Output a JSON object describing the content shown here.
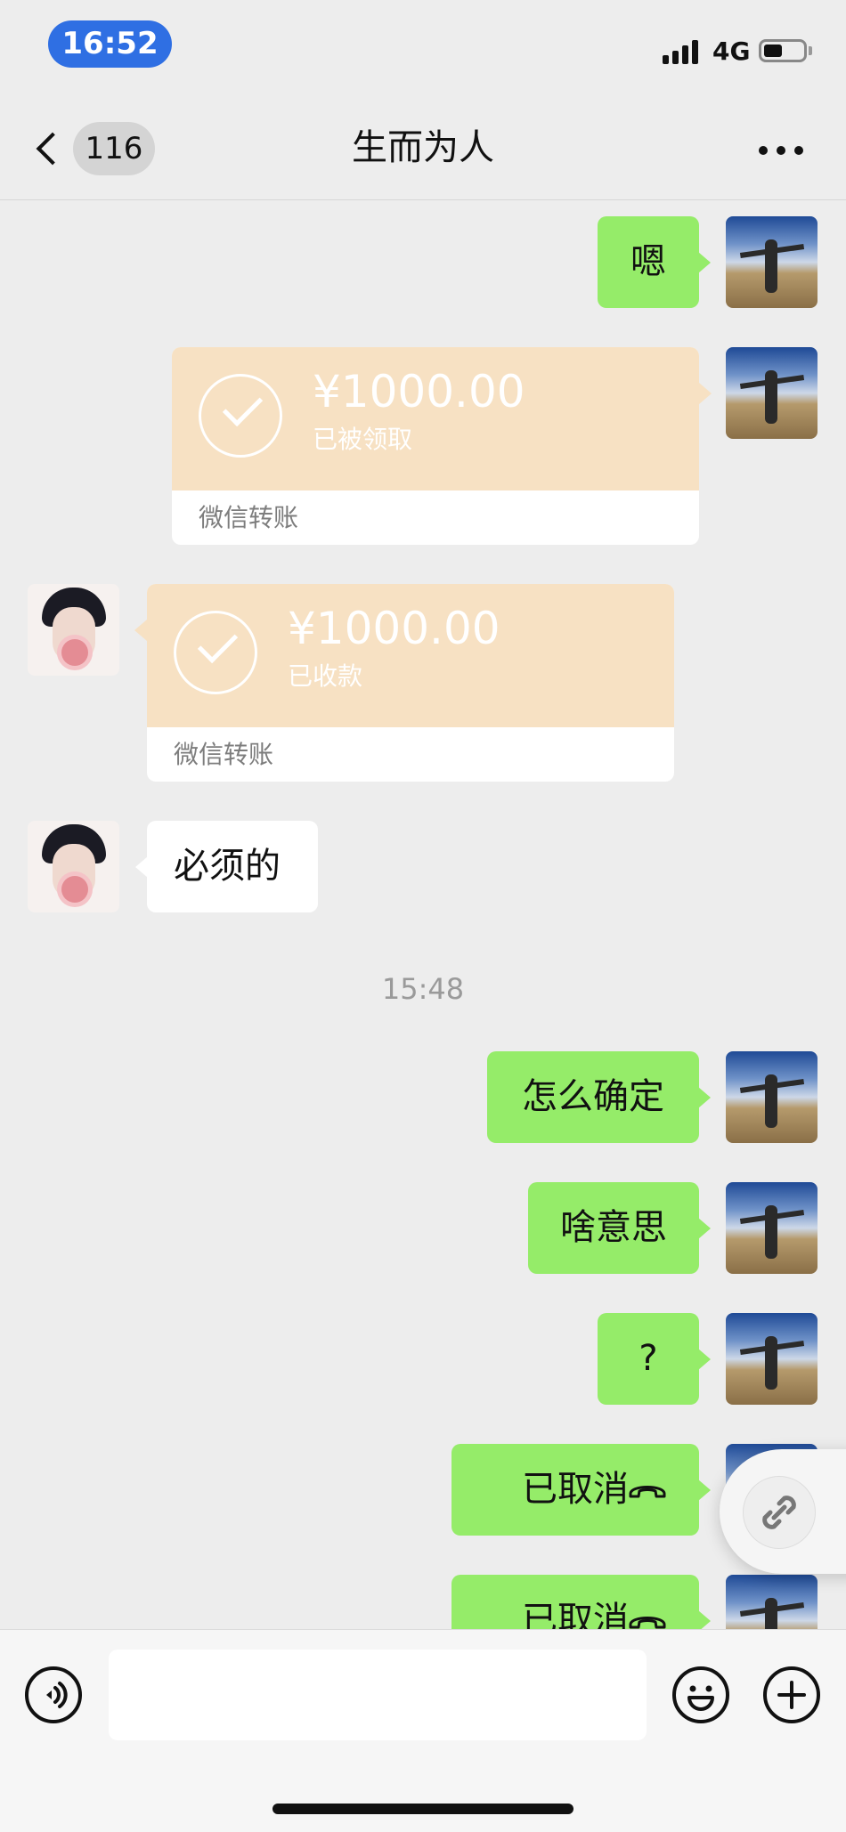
{
  "status_bar": {
    "time": "16:52",
    "network": "4G"
  },
  "nav": {
    "unread_count": "116",
    "title": "生而为人"
  },
  "messages": {
    "m1": {
      "text": "嗯"
    },
    "t1": {
      "amount": "¥1000.00",
      "status": "已被领取",
      "label": "微信转账"
    },
    "t2": {
      "amount": "¥1000.00",
      "status": "已收款",
      "label": "微信转账"
    },
    "m2": {
      "text": "必须的"
    },
    "time1": "15:48",
    "m3": {
      "text": "怎么确定"
    },
    "m4": {
      "text": "啥意思"
    },
    "m5": {
      "text": "?"
    },
    "c1": {
      "text": "已取消"
    },
    "c2": {
      "text": "已取消"
    }
  },
  "icons": {
    "back": "chevron-left-icon",
    "more": "ellipsis-icon",
    "voice": "voice-icon",
    "emoji": "emoji-icon",
    "plus": "plus-icon",
    "link": "link-icon",
    "hangup": "phone-hangup-icon"
  },
  "colors": {
    "outgoing_bubble": "#95ec69",
    "incoming_bubble": "#ffffff",
    "transfer": "#f7e1c3",
    "background": "#ededed",
    "time_pill": "#2f6fe3"
  },
  "input": {
    "value": ""
  }
}
